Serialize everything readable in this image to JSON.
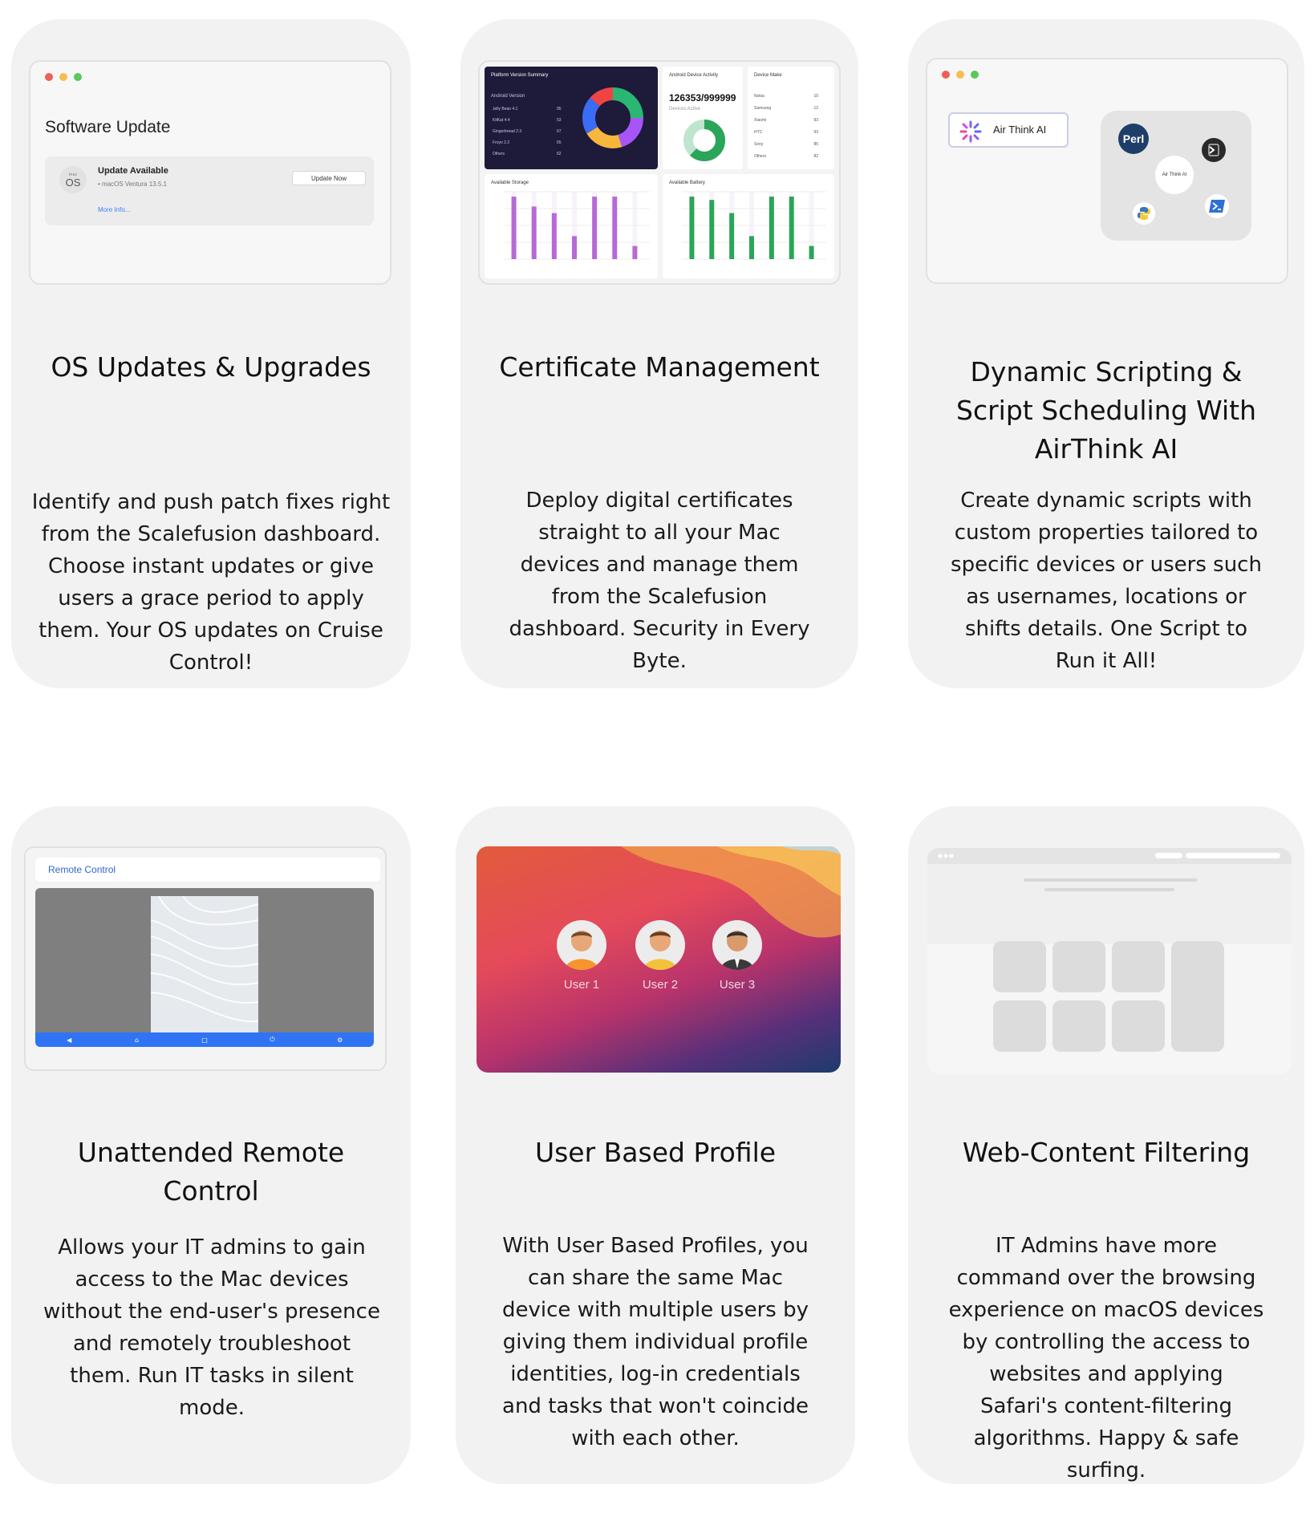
{
  "cards": [
    {
      "title": "OS Updates & Upgrades",
      "description": "Identify and push patch fixes right from the Scalefusion dashboard. Choose instant updates or give users a grace period to apply them. Your OS updates on Cruise Control!",
      "thumb": {
        "window_title": "Software Update",
        "os_badge_small": "mac",
        "os_badge_big": "OS",
        "status": "Update Available",
        "version": "• macOS Ventura 13.5.1",
        "more_info": "More Info...",
        "button": "Update Now"
      }
    },
    {
      "title": "Certificate Management",
      "description": "Deploy digital certificates straight to all your Mac devices and manage them from the Scalefusion dashboard. Security in Every Byte.",
      "thumb": {
        "platform_title": "Platform Version Summary",
        "platform_sub": "Android Version",
        "versions": [
          {
            "name": "Jelly Bean 4.1",
            "value": "95",
            "color": "#3b6cf6"
          },
          {
            "name": "KitKat 4.4",
            "value": "53",
            "color": "#a855f7"
          },
          {
            "name": "Gingerbread 2.3",
            "value": "67",
            "color": "#ef4444"
          },
          {
            "name": "Froyo 2.2",
            "value": "65",
            "color": "#f59e0b"
          },
          {
            "name": "Others",
            "value": "62",
            "color": "#f97316"
          }
        ],
        "activity_title": "Android Device Activity",
        "activity_value": "126353/999999",
        "activity_sub": "Devices Active",
        "make_title": "Device Make",
        "makes": [
          {
            "name": "Nokia",
            "value": "10"
          },
          {
            "name": "Samsung",
            "value": "12"
          },
          {
            "name": "Xiaomi",
            "value": "93"
          },
          {
            "name": "HTC",
            "value": "93"
          },
          {
            "name": "Sony",
            "value": "85"
          },
          {
            "name": "Others",
            "value": "82"
          }
        ],
        "storage_title": "Available Storage",
        "battery_title": "Available Battery",
        "storage_bars": [
          0.95,
          0.8,
          0.7,
          0.35,
          0.95,
          0.95,
          0.2
        ],
        "battery_bars": [
          0.95,
          0.9,
          0.7,
          0.35,
          0.95,
          0.95,
          0.2
        ],
        "storage_color": "#b66ad6",
        "battery_color": "#2aa55a"
      }
    },
    {
      "title": "Dynamic Scripting & Script Scheduling With AirThink AI",
      "description": "Create dynamic scripts with custom properties tailored to specific devices or users such as usernames, locations or shifts details. One Script to Run it All!",
      "thumb": {
        "button_label": "Air Think AI",
        "center_label": "Air Think AI",
        "perl": "Perl"
      }
    },
    {
      "title": "Unattended Remote Control",
      "description": "Allows your IT admins to gain access to the Mac devices without the end-user's presence and remotely troubleshoot them. Run IT tasks in silent mode.",
      "thumb": {
        "title": "Remote Control"
      }
    },
    {
      "title": "User Based Profile",
      "description": "With User Based Profiles, you can share the same Mac device with multiple users by giving them individual profile identities, log-in credentials and tasks that won't coincide with each other.",
      "thumb": {
        "users": [
          "User 1",
          "User 2",
          "User 3"
        ]
      }
    },
    {
      "title": "Web-Content Filtering",
      "description": "IT Admins have more command over the browsing experience on macOS devices by controlling the access to websites and applying Safari's content-filtering algorithms. Happy & safe surfing."
    }
  ]
}
